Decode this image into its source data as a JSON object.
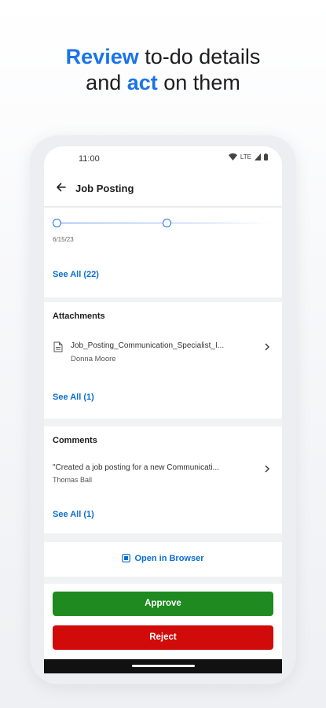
{
  "promo": {
    "line1_accent": "Review",
    "line1_rest": " to-do details",
    "line2_start": "and ",
    "line2_accent": "act",
    "line2_end": " on them"
  },
  "status_bar": {
    "time": "11:00",
    "network": "LTE"
  },
  "app_bar": {
    "title": "Job Posting"
  },
  "timeline": {
    "date": "6/15/23",
    "see_all": "See All (22)"
  },
  "attachments": {
    "title": "Attachments",
    "items": [
      {
        "name": "Job_Posting_Communication_Specialist_I...",
        "author": "Donna Moore"
      }
    ],
    "see_all": "See All (1)"
  },
  "comments": {
    "title": "Comments",
    "items": [
      {
        "text": "\"Created a job posting for a new Communicati...",
        "author": "Thomas Ball"
      }
    ],
    "see_all": "See All (1)"
  },
  "browser": {
    "label": "Open in Browser"
  },
  "actions": {
    "approve": "Approve",
    "reject": "Reject"
  },
  "colors": {
    "accent": "#1a73e8",
    "link": "#0a6ed1",
    "approve": "#1e8a1f",
    "reject": "#d10a0a"
  }
}
